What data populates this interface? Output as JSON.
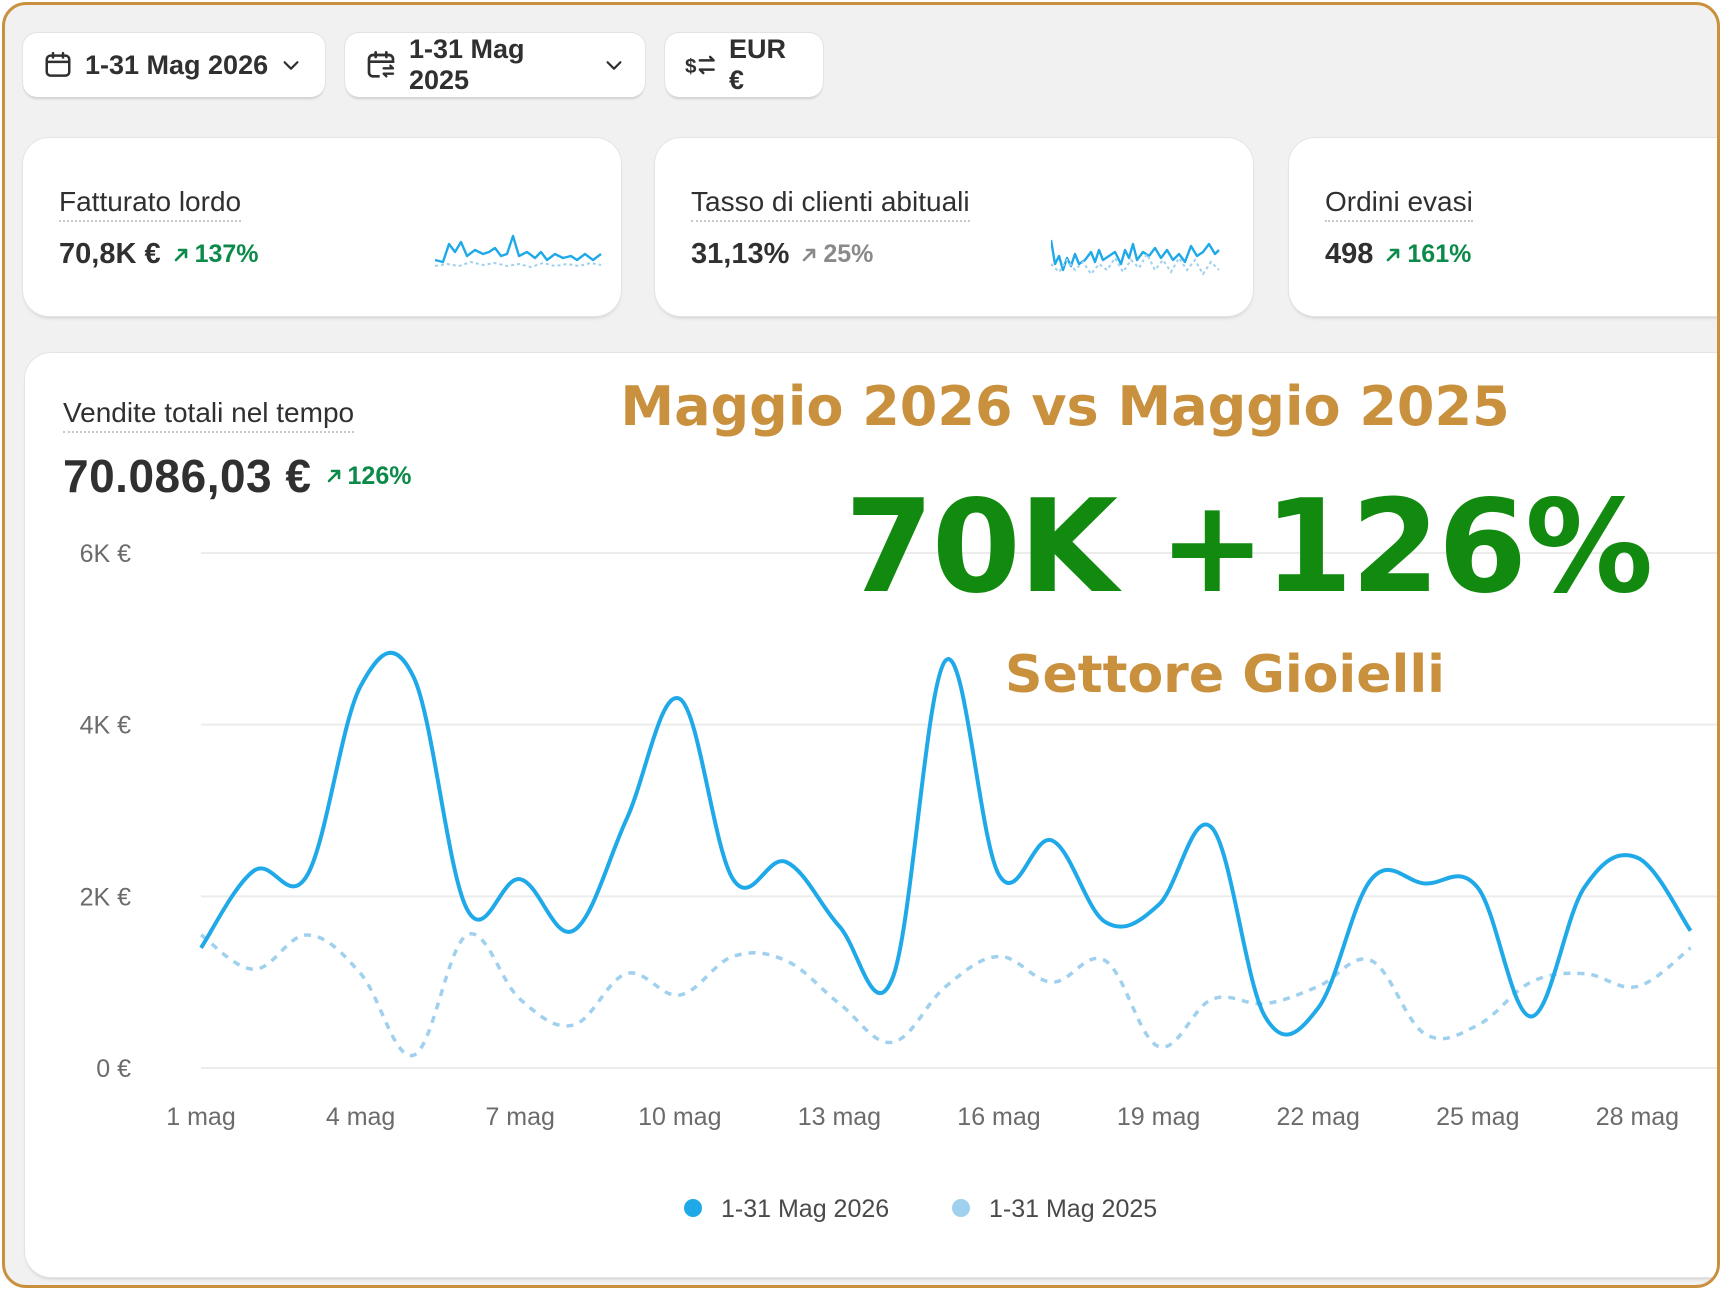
{
  "toolbar": {
    "date_range": "1-31 Mag 2026",
    "compare_range": "1-31 Mag 2025",
    "currency": "EUR €"
  },
  "metrics": [
    {
      "title": "Fatturato lordo",
      "value": "70,8K €",
      "delta": "137%",
      "trend": "up"
    },
    {
      "title": "Tasso di clienti abituali",
      "value": "31,13%",
      "delta": "25%",
      "trend": "neutral"
    },
    {
      "title": "Ordini evasi",
      "value": "498",
      "delta": "161%",
      "trend": "up"
    }
  ],
  "chart_card": {
    "title": "Vendite totali nel tempo",
    "total": "70.086,03 €",
    "delta": "126%"
  },
  "overlay": {
    "headline": "Maggio 2026 vs Maggio 2025",
    "big": "70K +126%",
    "sub": "Settore Gioielli"
  },
  "colors": {
    "current_series": "#1fa9e8",
    "previous_series": "#9fd0ee",
    "positive": "#0c8a4a",
    "accent_gold": "#c9913e",
    "overlay_green": "#128a0f"
  },
  "chart_data": {
    "type": "line",
    "x": [
      "1 mag",
      "2 mag",
      "3 mag",
      "4 mag",
      "5 mag",
      "6 mag",
      "7 mag",
      "8 mag",
      "9 mag",
      "10 mag",
      "11 mag",
      "12 mag",
      "13 mag",
      "14 mag",
      "15 mag",
      "16 mag",
      "17 mag",
      "18 mag",
      "19 mag",
      "20 mag",
      "21 mag",
      "22 mag",
      "23 mag",
      "24 mag",
      "25 mag",
      "26 mag",
      "27 mag",
      "28 mag",
      "29 mag"
    ],
    "x_ticks": [
      "1 mag",
      "4 mag",
      "7 mag",
      "10 mag",
      "13 mag",
      "16 mag",
      "19 mag",
      "22 mag",
      "25 mag",
      "28 mag"
    ],
    "y_ticks": [
      "0 €",
      "2K €",
      "4K €",
      "6K €"
    ],
    "ylim": [
      0,
      6000
    ],
    "grid": true,
    "legend_position": "bottom",
    "series": [
      {
        "name": "1-31 Mag 2026",
        "style": "solid",
        "values": [
          1400,
          2300,
          2250,
          4450,
          4550,
          1850,
          2200,
          1600,
          2900,
          4300,
          2200,
          2400,
          1650,
          1050,
          4750,
          2250,
          2650,
          1700,
          1900,
          2800,
          600,
          700,
          2200,
          2150,
          2100,
          600,
          2100,
          2450,
          1600
        ]
      },
      {
        "name": "1-31 Mag 2025",
        "style": "dashed",
        "values": [
          1550,
          1150,
          1550,
          1100,
          150,
          1550,
          800,
          500,
          1100,
          850,
          1300,
          1250,
          750,
          300,
          950,
          1300,
          1000,
          1250,
          250,
          800,
          750,
          950,
          1250,
          400,
          500,
          1000,
          1100,
          950,
          1400
        ]
      }
    ]
  }
}
